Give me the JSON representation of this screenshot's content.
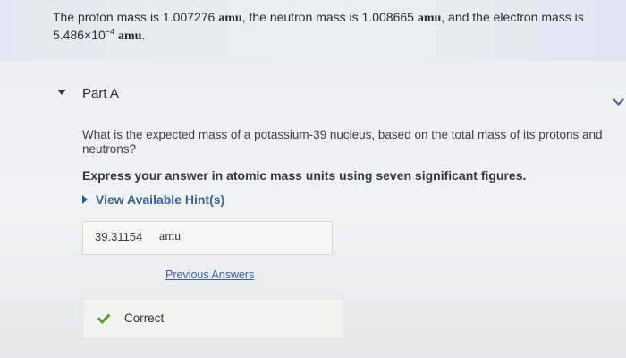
{
  "intro": {
    "proton_prefix": "The proton mass is 1.007276",
    "proton_unit": "amu",
    "neutron_prefix": ", the neutron mass is 1.008665",
    "neutron_unit": "amu",
    "electron_prefix": ", and the electron mass is",
    "electron_mantissa": "5.486×10",
    "electron_exponent": "−4",
    "electron_unit": "amu",
    "end": "."
  },
  "part": {
    "title": "Part A"
  },
  "question": {
    "text": "What is the expected mass of a potassium-39 nucleus, based on the total mass of its protons and neutrons?",
    "instruction": "Express your answer in atomic mass units using seven significant figures."
  },
  "hint": {
    "label": "View Available Hint(s)"
  },
  "answer": {
    "value": "39.31154",
    "unit": "amu"
  },
  "previous_answers": {
    "label": "Previous Answers"
  },
  "feedback": {
    "status": "Correct",
    "status_color": "#5c9a3c"
  },
  "colors": {
    "link": "#3a62a6",
    "hint": "#3a5f8e",
    "intro_bg": "#e6ecf2"
  },
  "icons": {
    "part_toggle": "caret-down-icon",
    "hint_toggle": "caret-right-icon",
    "next": "chevron-right-icon",
    "status": "check-icon"
  }
}
